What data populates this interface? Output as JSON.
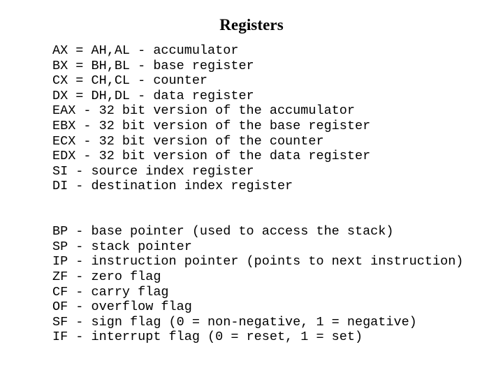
{
  "slide": {
    "title": "Registers",
    "background_color": "#ffffff",
    "text_color": "#000000"
  },
  "content": {
    "groups": [
      {
        "name": "general-and-index-registers",
        "lines": [
          "AX = AH,AL - accumulator",
          "BX = BH,BL - base register",
          "CX = CH,CL - counter",
          "DX = DH,DL - data register",
          "EAX - 32 bit version of the accumulator",
          "EBX - 32 bit version of the base register",
          "ECX - 32 bit version of the counter",
          "EDX - 32 bit version of the data register",
          "SI - source index register",
          "DI - destination index register"
        ]
      },
      {
        "name": "pointers-and-flags",
        "lines": [
          "BP - base pointer (used to access the stack)",
          "SP - stack pointer",
          "IP - instruction pointer (points to next instruction)",
          "ZF - zero flag",
          "CF - carry flag",
          "OF - overflow flag",
          "SF - sign flag (0 = non-negative, 1 = negative)",
          "IF - interrupt flag (0 = reset, 1 = set)"
        ]
      }
    ]
  }
}
